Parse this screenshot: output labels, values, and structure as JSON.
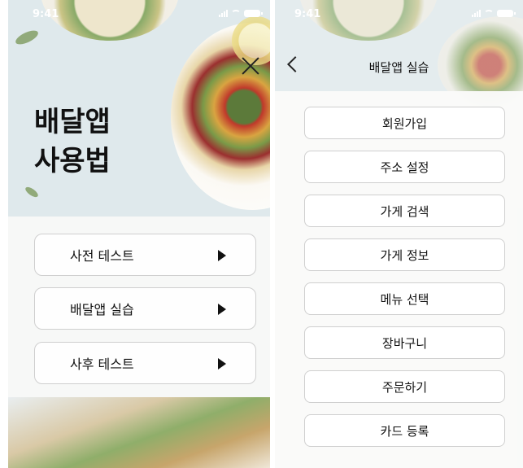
{
  "status_bar": {
    "time": "9:41"
  },
  "left_screen": {
    "title_line1": "배달앱",
    "title_line2": "사용법",
    "menu": [
      {
        "label": "사전 테스트"
      },
      {
        "label": "배달앱 실습"
      },
      {
        "label": "사후 테스트"
      }
    ]
  },
  "right_screen": {
    "header_title": "배달앱 실습",
    "items": [
      {
        "label": "회원가입"
      },
      {
        "label": "주소 설정"
      },
      {
        "label": "가게 검색"
      },
      {
        "label": "가게 정보"
      },
      {
        "label": "메뉴 선택"
      },
      {
        "label": "장바구니"
      },
      {
        "label": "주문하기"
      },
      {
        "label": "카드 등록"
      }
    ]
  },
  "icons": {
    "close": "close-icon",
    "back": "chevron-left-icon",
    "play": "play-triangle-icon",
    "signal": "signal-icon",
    "wifi": "wifi-icon",
    "battery": "battery-icon"
  }
}
